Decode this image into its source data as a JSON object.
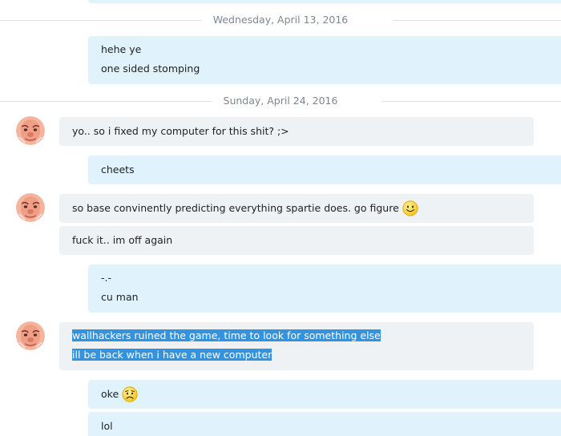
{
  "separators": [
    {
      "label": "Wednesday, April 13, 2016"
    },
    {
      "label": "Sunday, April 24, 2016"
    }
  ],
  "messages": {
    "m1": {
      "lines": [
        "hehe ye",
        "one sided stomping"
      ]
    },
    "m2": {
      "lines": [
        "yo.. so i fixed my computer for this shit? ;>"
      ]
    },
    "m3": {
      "lines": [
        "cheets"
      ]
    },
    "m4": {
      "lines": [
        "so base convinently predicting everything spartie does. go figure"
      ],
      "emoji": "smile-emoji"
    },
    "m5": {
      "lines": [
        "fuck it.. im off again"
      ]
    },
    "m6": {
      "lines": [
        "-.-",
        "cu man"
      ]
    },
    "m7": {
      "lines": [
        "wallhackers ruined the game, time to look for something else",
        "ill be back when i have a new computer"
      ],
      "selected": true
    },
    "m8": {
      "lines": [
        "oke"
      ],
      "emoji": "worried-emoji"
    },
    "m9": {
      "lines": [
        "lol"
      ]
    }
  },
  "colors": {
    "outgoing_bubble": "#e0f3fc",
    "incoming_bubble": "#eff2f5",
    "selection": "#3393df",
    "separator_text": "#7c8791"
  }
}
